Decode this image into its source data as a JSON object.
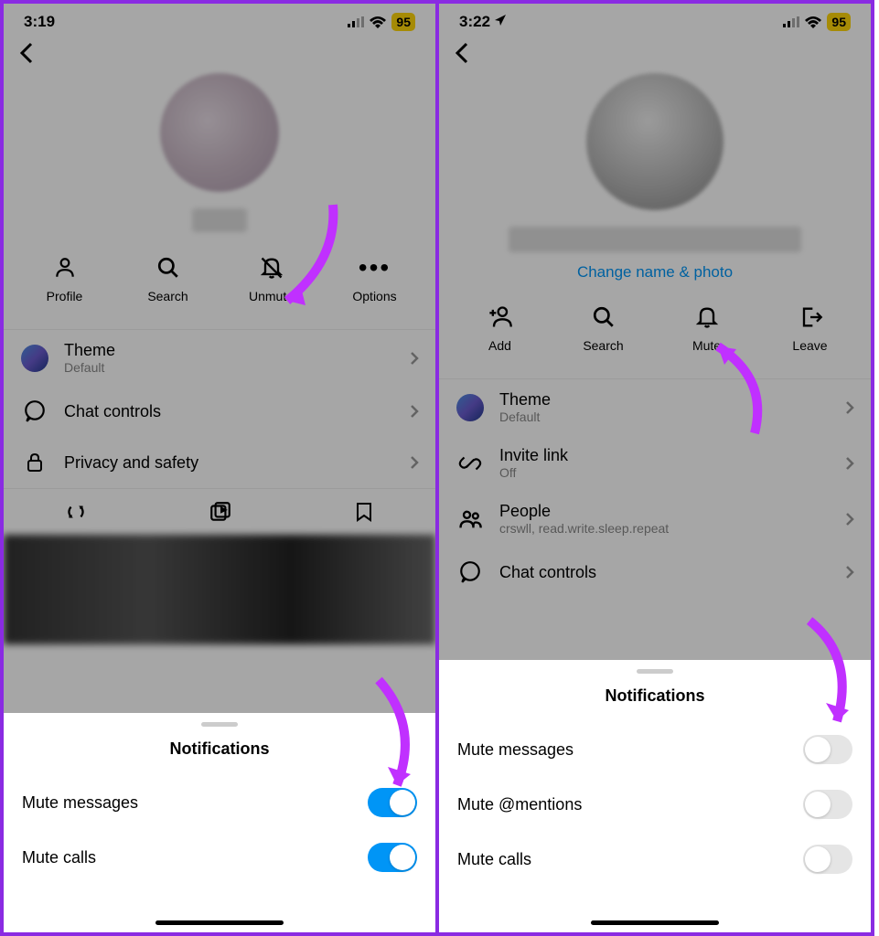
{
  "left": {
    "status": {
      "time": "3:19",
      "battery": "95"
    },
    "actions": {
      "profile": "Profile",
      "search": "Search",
      "unmute": "Unmute",
      "options": "Options"
    },
    "settings": {
      "theme_title": "Theme",
      "theme_sub": "Default",
      "chat_controls": "Chat controls",
      "privacy": "Privacy and safety"
    },
    "sheet": {
      "title": "Notifications",
      "mute_messages": "Mute messages",
      "mute_calls": "Mute calls"
    }
  },
  "right": {
    "status": {
      "time": "3:22",
      "battery": "95"
    },
    "change_link": "Change name & photo",
    "actions": {
      "add": "Add",
      "search": "Search",
      "mute": "Mute",
      "leave": "Leave"
    },
    "settings": {
      "theme_title": "Theme",
      "theme_sub": "Default",
      "invite_title": "Invite link",
      "invite_sub": "Off",
      "people_title": "People",
      "people_sub": "crswll, read.write.sleep.repeat",
      "chat_controls": "Chat controls"
    },
    "sheet": {
      "title": "Notifications",
      "mute_messages": "Mute messages",
      "mute_mentions": "Mute @mentions",
      "mute_calls": "Mute calls"
    }
  }
}
